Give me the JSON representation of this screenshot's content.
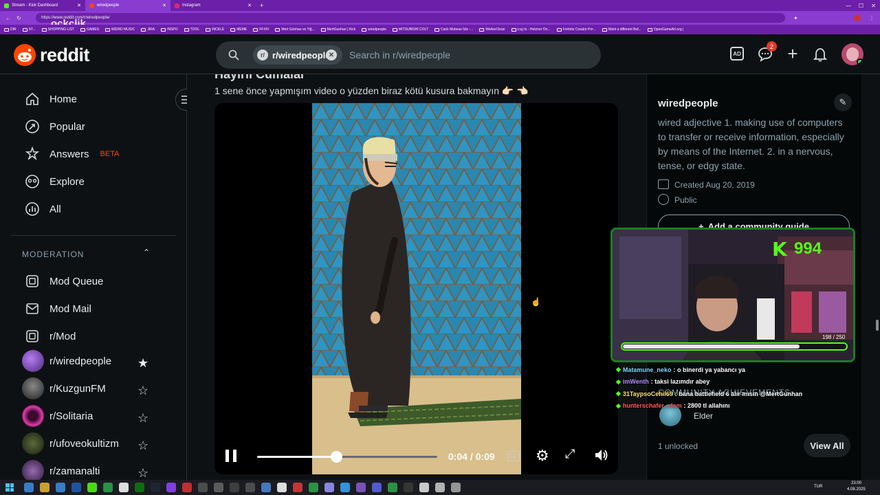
{
  "browser": {
    "tabs": [
      {
        "label": "Stream - Kick Dashboard",
        "color": "#53fc18"
      },
      {
        "label": "wiredpeople",
        "color": "#ff4500"
      },
      {
        "label": "Instagram",
        "color": "#d62976"
      }
    ],
    "url": "https://www.reddit.com/r/wiredpeople/",
    "watermark": "ockclik",
    "bookmarks": [
      "DIR",
      "ST...",
      "SHOPPING LIST",
      "GAMES",
      "WEIRD MUSIC",
      "JIRA",
      "INSPO",
      "TOOL",
      "INCELE",
      "MEME",
      "FFXIV",
      "Mert Günhan ve Yiğ...",
      "MertGunhan | Kick",
      "wiredpeople",
      "MITSUBISHI COLT",
      "Canlı Mobese İzle -...",
      "WeAreClean",
      "Log In - Hetzner On...",
      "Fortnite Creator Por...",
      "Want a different Buf...",
      "OpenGameArt.org |"
    ]
  },
  "header": {
    "brand": "reddit",
    "subreddit_chip": "r/wiredpeople",
    "search_placeholder": "Search in r/wiredpeople",
    "chat_badge": "2"
  },
  "sidebar": {
    "nav": [
      {
        "label": "Home",
        "icon": "home-icon"
      },
      {
        "label": "Popular",
        "icon": "popular-icon"
      },
      {
        "label": "Answers",
        "icon": "answers-icon",
        "badge": "BETA"
      },
      {
        "label": "Explore",
        "icon": "explore-icon"
      },
      {
        "label": "All",
        "icon": "all-icon"
      }
    ],
    "moderation_heading": "MODERATION",
    "moderation": [
      {
        "label": "Mod Queue",
        "icon": "mod-queue-icon"
      },
      {
        "label": "Mod Mail",
        "icon": "mod-mail-icon"
      },
      {
        "label": "r/Mod",
        "icon": "mod-icon"
      }
    ],
    "communities": [
      {
        "label": "r/wiredpeople",
        "favorite": true,
        "color": "#6b3fa0"
      },
      {
        "label": "r/KuzgunFM",
        "favorite": false,
        "color": "#3a3a3a"
      },
      {
        "label": "r/Solitaria",
        "favorite": false,
        "color": "#c1268d"
      },
      {
        "label": "r/ufoveokultizm",
        "favorite": false,
        "color": "#445533"
      },
      {
        "label": "r/zamanalti",
        "favorite": false,
        "color": "#5a3a6a"
      }
    ]
  },
  "post": {
    "title": "Hayırlı Cumalar",
    "text": "1 sene önce yapmışım video o yüzden biraz kötü kusura bakmayın 👉🏻 👈🏻",
    "video": {
      "time": "0:04 / 0:09",
      "progress": 0.44,
      "cc": "CC"
    }
  },
  "community": {
    "name": "wiredpeople",
    "description": "wired adjective 1. making use of computers to transfer or receive information, especially by means of the Internet. 2. in a nervous, tense, or edgy state.",
    "created": "Created Aug 20, 2019",
    "visibility": "Public",
    "guide_button": "Add a community guide",
    "achievements_heading": "COMMUNITY ACHIEVEMENTS",
    "achievement": "Elder",
    "unlocked": "1 unlocked",
    "view_all": "View All"
  },
  "stream_overlay": {
    "viewer_count": "994",
    "goal_text": "198 / 250",
    "goal_progress": 0.792
  },
  "chat": [
    {
      "user": "Matamune_neko",
      "message": ": o binerdi ya yabancı ya",
      "color": "#7fd4ff"
    },
    {
      "user": "imWenth",
      "message": ": taksi lazımdır abey",
      "color": "#b48cff"
    },
    {
      "user": "31TaypsoCehil69",
      "message": ": bana battlefield 6 alır mısın @MertGunhan",
      "color": "#ffe066"
    },
    {
      "user": "hunterschafer...dam",
      "message": ": 2800 tl allahını",
      "color": "#ff5a5a"
    }
  ],
  "taskbar": {
    "lang": "TUR",
    "time": "23:00",
    "date": "4.08.2025"
  }
}
